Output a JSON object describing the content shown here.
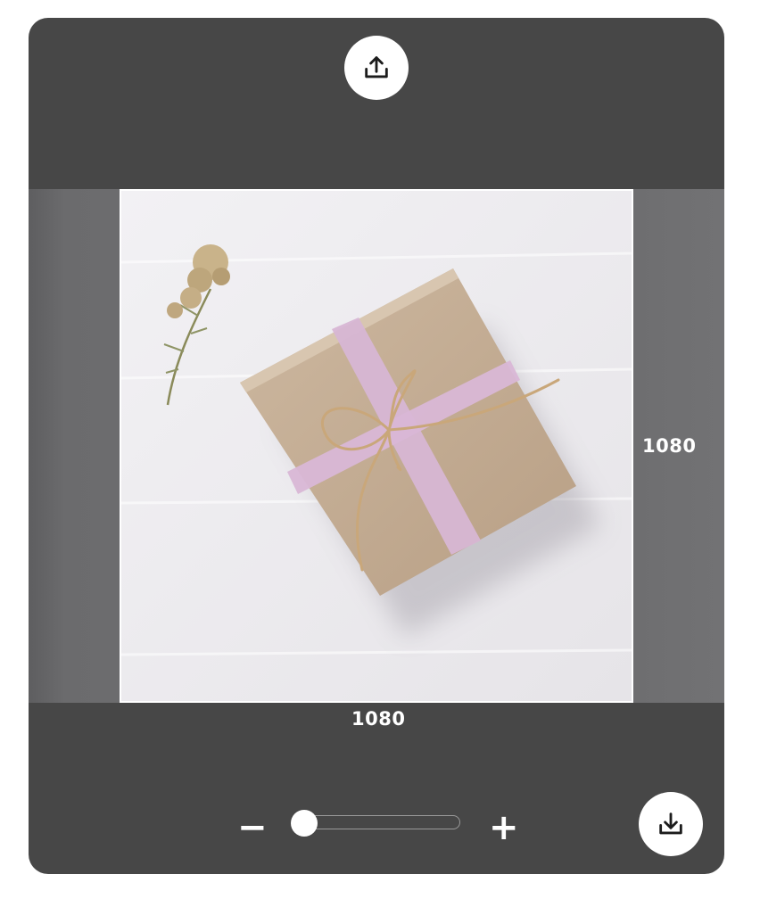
{
  "toolbar": {
    "upload_icon": "upload-icon",
    "download_icon": "download-icon"
  },
  "canvas": {
    "image_subject": "gift-box-photo",
    "width_label": "1080",
    "height_label": "1080"
  },
  "zoom": {
    "minus_label": "−",
    "plus_label": "+",
    "level": 0.0
  },
  "colors": {
    "panel": "#474747",
    "stage": "#6d6d6f",
    "accent": "#ffffff"
  }
}
